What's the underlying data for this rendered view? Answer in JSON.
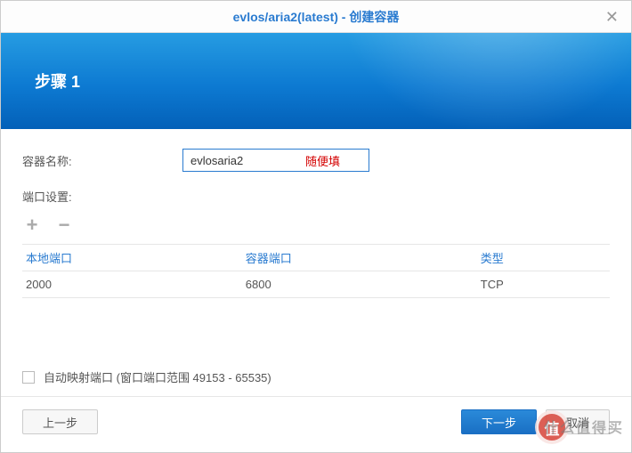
{
  "window": {
    "title": "evlos/aria2(latest) - 创建容器"
  },
  "banner": {
    "step_label": "步骤 1"
  },
  "form": {
    "container_name_label": "容器名称:",
    "container_name_value": "evlosaria2",
    "hint": "随便填",
    "port_section_label": "端口设置:",
    "add_label": "+",
    "remove_label": "−"
  },
  "table": {
    "headers": {
      "local_port": "本地端口",
      "container_port": "容器端口",
      "type": "类型"
    },
    "rows": [
      {
        "local_port": "2000",
        "container_port": "6800",
        "type": "TCP"
      }
    ]
  },
  "auto_map": {
    "label": "自动映射端口 (窗口端口范围 49153 - 65535)"
  },
  "buttons": {
    "prev": "上一步",
    "next": "下一步",
    "cancel": "取消"
  },
  "watermark": {
    "badge": "值",
    "text": "什么值得买"
  }
}
